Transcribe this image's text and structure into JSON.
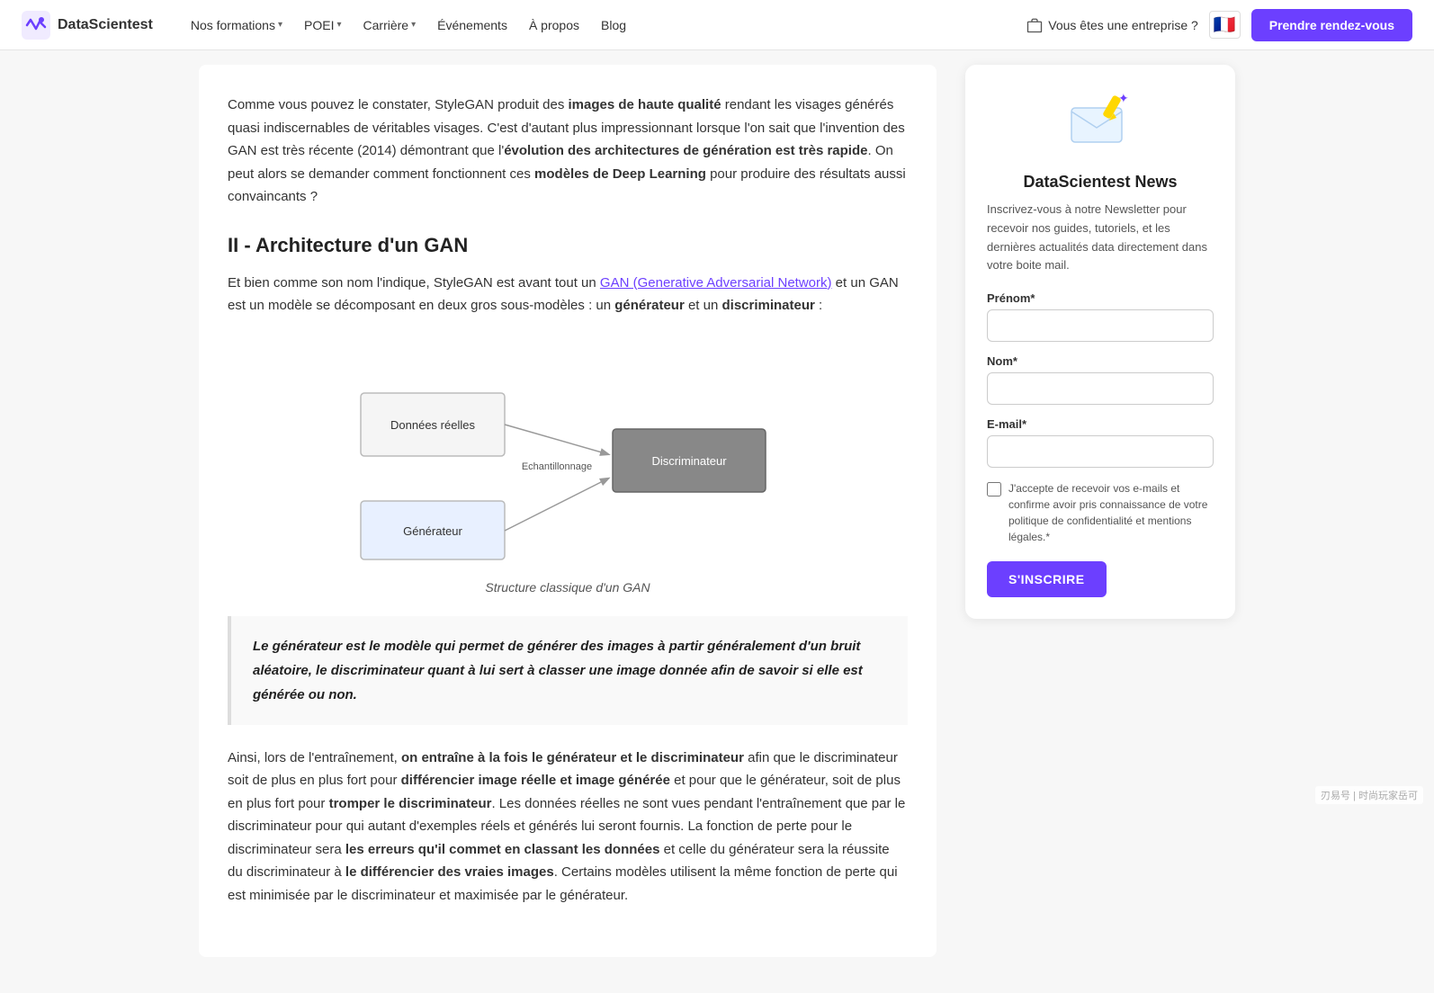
{
  "nav": {
    "logo_text": "DataScientest",
    "links": [
      {
        "label": "Nos formations",
        "has_dropdown": true
      },
      {
        "label": "POEI",
        "has_dropdown": true
      },
      {
        "label": "Carrière",
        "has_dropdown": true
      },
      {
        "label": "Événements",
        "has_dropdown": false
      },
      {
        "label": "À propos",
        "has_dropdown": false
      },
      {
        "label": "Blog",
        "has_dropdown": false
      }
    ],
    "enterprise_label": "Vous êtes une entreprise ?",
    "cta_label": "Prendre rendez-vous"
  },
  "article": {
    "intro": "Comme vous pouvez le constater, StyleGAN produit des images de haute qualité rendant les visages générés quasi indiscernables de véritables visages. C'est d'autant plus impressionnant lorsque l'on sait que l'invention des GAN est très récente (2014) démontrant que l'évolution des architectures de génération est très rapide. On peut alors se demander comment fonctionnent ces modèles de Deep Learning pour produire des résultats aussi convaincants ?",
    "section_heading": "II - Architecture d'un GAN",
    "section_text_1_before": "Et bien comme son nom l'indique, StyleGAN est avant tout un ",
    "section_link": "GAN (Generative Adversarial Network)",
    "section_text_1_after": " et un GAN est un modèle se décomposant en deux gros sous-modèles : un générateur et un discriminateur :",
    "diagram_caption": "Structure classique d'un GAN",
    "diagram": {
      "node_donnees": "Données réelles",
      "node_generateur": "Générateur",
      "node_discriminateur": "Discriminateur",
      "label_echantillonnage": "Echantillonnage"
    },
    "blockquote": "Le générateur est le modèle qui permet de générer des images à partir généralement d'un bruit aléatoire, le discriminateur quant à lui sert à classer une image donnée afin de savoir si elle est générée ou non.",
    "paragraph_2": "Ainsi, lors de l'entraînement, on entraîne à la fois le générateur et le discriminateur afin que le discriminateur soit de plus en plus fort pour différencier image réelle et image générée et pour que le générateur, soit de plus en plus fort pour tromper le discriminateur. Les données réelles ne sont vues pendant l'entraînement que par le discriminateur pour qui autant d'exemples réels et générés lui seront fournis. La fonction de perte pour le discriminateur sera les erreurs qu'il commet en classant les données et celle du générateur sera la réussite du discriminateur à le différencier des vraies images. Certains modèles utilisent la même fonction de perte qui est minimisée par le discriminateur et maximisée par le générateur."
  },
  "sidebar": {
    "card_title": "DataScientest News",
    "card_desc": "Inscrivez-vous à notre Newsletter pour recevoir nos guides, tutoriels, et les dernières actualités data directement dans votre boite mail.",
    "prenom_label": "Prénom*",
    "prenom_placeholder": "",
    "nom_label": "Nom*",
    "nom_placeholder": "",
    "email_label": "E-mail*",
    "email_placeholder": "",
    "checkbox_label": "J'accepte de recevoir vos e-mails et confirme avoir pris connaissance de votre politique de confidentialité et mentions légales.*",
    "submit_label": "S'INSCRIRE"
  }
}
